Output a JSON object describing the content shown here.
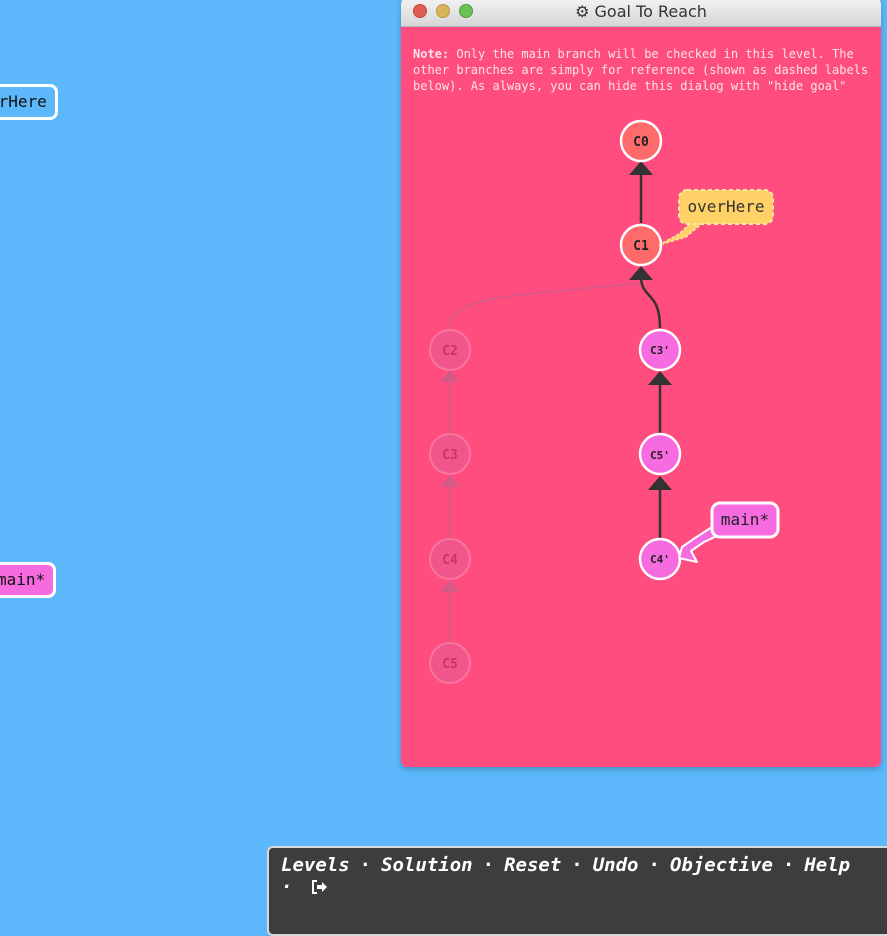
{
  "background_tags": {
    "overhere": "erHere",
    "main": "main*"
  },
  "goal_window": {
    "title": "Goal To Reach",
    "note_label": "Note:",
    "note_text": "Only the main branch will be checked in this level. The other branches are simply for reference (shown as dashed labels below). As always, you can hide this dialog with \"hide goal\""
  },
  "graph": {
    "commits": {
      "c0": "C0",
      "c1": "C1",
      "c2": "C2",
      "c3": "C3",
      "c4": "C4",
      "c5": "C5",
      "c3p": "C3'",
      "c5p": "C5'",
      "c4p": "C4'"
    },
    "branches": {
      "overhere": "overHere",
      "main": "main*"
    }
  },
  "footer": {
    "levels": "Levels",
    "solution": "Solution",
    "reset": "Reset",
    "undo": "Undo",
    "objective": "Objective",
    "help": "Help",
    "separator": "·",
    "exit_icon": "sign-out-icon"
  },
  "colors": {
    "background": "#5cb8fa",
    "goal_bg": "#ff4d7f",
    "main_branch": "#f66be0",
    "overhere_branch": "#ffd166",
    "base_commit": "#ff6b6b"
  }
}
